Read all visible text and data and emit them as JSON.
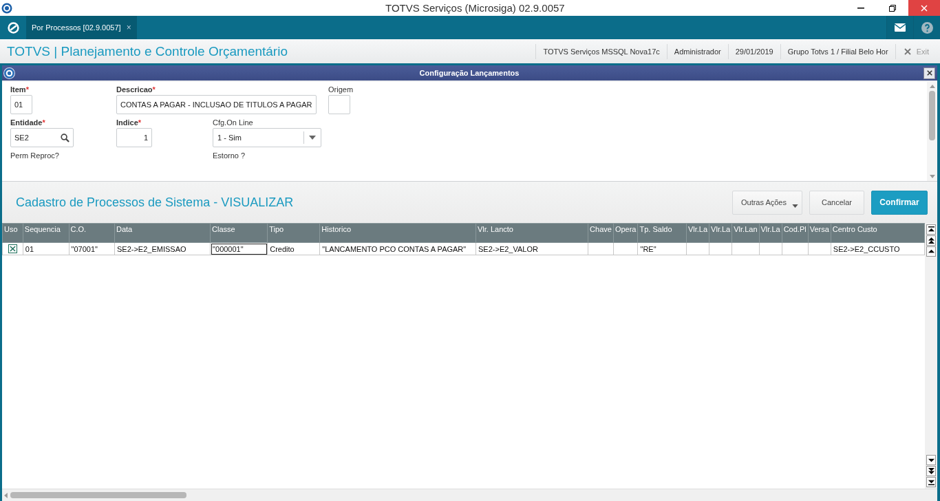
{
  "window": {
    "title": "TOTVS Serviços (Microsiga) 02.9.0057"
  },
  "tabs": [
    {
      "label": "Por Processos [02.9.0057]",
      "close": "×",
      "selected": true
    }
  ],
  "header": {
    "title": "TOTVS | Planejamento e Controle Orçamentário",
    "info": [
      "TOTVS Serviços MSSQL Nova17c",
      "Administrador",
      "29/01/2019",
      "Grupo Totvs 1 / Filial Belo Hor"
    ],
    "exit": "Exit"
  },
  "dialog": {
    "title": "Configuração Lançamentos"
  },
  "form": {
    "fields": [
      {
        "label": "Item",
        "marker": "*",
        "value": "01",
        "kind": "text"
      },
      {
        "label": "Descricao",
        "marker": "*",
        "value": "CONTAS A PAGAR - INCLUSAO DE TITULOS A PAGAR",
        "kind": "text"
      },
      {
        "label": "Origem",
        "kind": "text"
      },
      {
        "label": "Entidade",
        "marker": "*",
        "value": "SE2",
        "kind": "lookup"
      },
      {
        "label": "Indice",
        "marker": "*",
        "value": "1",
        "kind": "number"
      },
      {
        "label": "Cfg.On Line",
        "value": "1 - Sim",
        "kind": "select"
      },
      {
        "label": "Perm Reproc?",
        "kind": "label"
      },
      {
        "label": "Estorno ?",
        "kind": "label"
      }
    ]
  },
  "section_title": "Cadastro de Processos de Sistema - VISUALIZAR",
  "buttons": [
    {
      "label": "Outras Ações",
      "kind": "menu"
    },
    {
      "label": "Cancelar",
      "kind": "plain"
    },
    {
      "label": "Confirmar",
      "kind": "primary"
    }
  ],
  "table": {
    "columns": [
      "Uso",
      "Sequencia",
      "C.O.",
      "Data",
      "Classe",
      "Tipo",
      "Historico",
      "Vlr. Lancto",
      "Chave",
      "Opera",
      "Tp. Saldo",
      "Vlr.La",
      "Vlr.La",
      "Vlr.Lan",
      "Vlr.La",
      "Cod.Pl",
      "Versa",
      "Centro Custo"
    ],
    "rows": [
      {
        "cells": [
          {
            "kind": "checkbox",
            "checked": true
          },
          {
            "kind": "text",
            "text": "01",
            "selected": false
          },
          {
            "kind": "text",
            "text": "\"07001\"",
            "selected": false
          },
          {
            "kind": "text",
            "text": "SE2->E2_EMISSAO",
            "selected": false
          },
          {
            "kind": "text",
            "text": "\"000001\"",
            "selected": true
          },
          {
            "kind": "text",
            "text": "Credito",
            "selected": false
          },
          {
            "kind": "text",
            "text": "\"LANCAMENTO PCO CONTAS A PAGAR\"",
            "selected": false
          },
          {
            "kind": "text",
            "text": "SE2->E2_VALOR",
            "selected": false
          },
          {
            "kind": "text",
            "selected": false
          },
          {
            "kind": "text",
            "selected": false
          },
          {
            "kind": "text",
            "text": "\"RE\"",
            "selected": false
          },
          {
            "kind": "text",
            "selected": false
          },
          {
            "kind": "text",
            "selected": false
          },
          {
            "kind": "text",
            "selected": false
          },
          {
            "kind": "text",
            "selected": false
          },
          {
            "kind": "text",
            "selected": false
          },
          {
            "kind": "text",
            "selected": false
          },
          {
            "kind": "text",
            "text": "SE2->E2_CCUSTO",
            "selected": false
          }
        ]
      }
    ]
  }
}
